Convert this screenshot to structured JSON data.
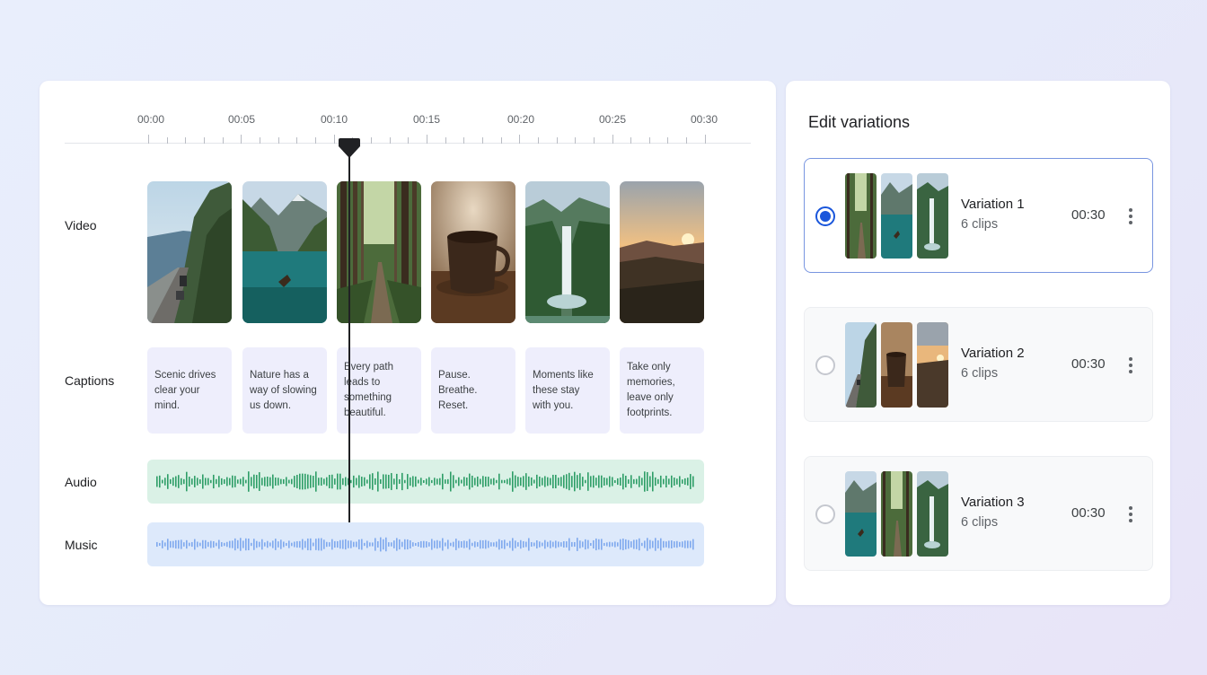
{
  "timeline": {
    "ticks": [
      "00:00",
      "00:05",
      "00:10",
      "00:15",
      "00:20",
      "00:25",
      "00:30"
    ],
    "playhead_time": "00:11",
    "tracks": {
      "video_label": "Video",
      "captions_label": "Captions",
      "audio_label": "Audio",
      "music_label": "Music"
    },
    "video_clips": [
      {
        "icon": "mountain-road-thumbnail"
      },
      {
        "icon": "lake-boat-thumbnail"
      },
      {
        "icon": "forest-path-thumbnail"
      },
      {
        "icon": "coffee-cup-thumbnail"
      },
      {
        "icon": "waterfall-thumbnail"
      },
      {
        "icon": "sunset-thumbnail"
      }
    ],
    "captions": [
      "Scenic drives\nclear your mind.",
      "Nature has a\nway of slowing\nus down.",
      "Every path\nleads to\nsomething\nbeautiful.",
      "Pause.\nBreathe.\nReset.",
      "Moments like\nthese stay\nwith you.",
      "Take only\nmemories,\nleave only\nfootprints."
    ],
    "colors": {
      "audio_wave": "#2e9e67",
      "audio_bg": "#daf1e6",
      "music_wave": "#7fa9ee",
      "music_bg": "#dde9fb",
      "caption_bg": "#eeeefc"
    }
  },
  "variations": {
    "title": "Edit variations",
    "items": [
      {
        "name": "Variation 1",
        "clips": "6 clips",
        "duration": "00:30",
        "selected": true,
        "thumbs": [
          "forest-path-thumbnail",
          "lake-boat-thumbnail",
          "waterfall-thumbnail"
        ]
      },
      {
        "name": "Variation 2",
        "clips": "6 clips",
        "duration": "00:30",
        "selected": false,
        "thumbs": [
          "mountain-road-thumbnail",
          "coffee-cup-thumbnail",
          "sunset-thumbnail"
        ]
      },
      {
        "name": "Variation 3",
        "clips": "6 clips",
        "duration": "00:30",
        "selected": false,
        "thumbs": [
          "lake-boat-thumbnail",
          "forest-path-thumbnail",
          "waterfall-thumbnail"
        ]
      }
    ],
    "accent": "#1a56db"
  }
}
